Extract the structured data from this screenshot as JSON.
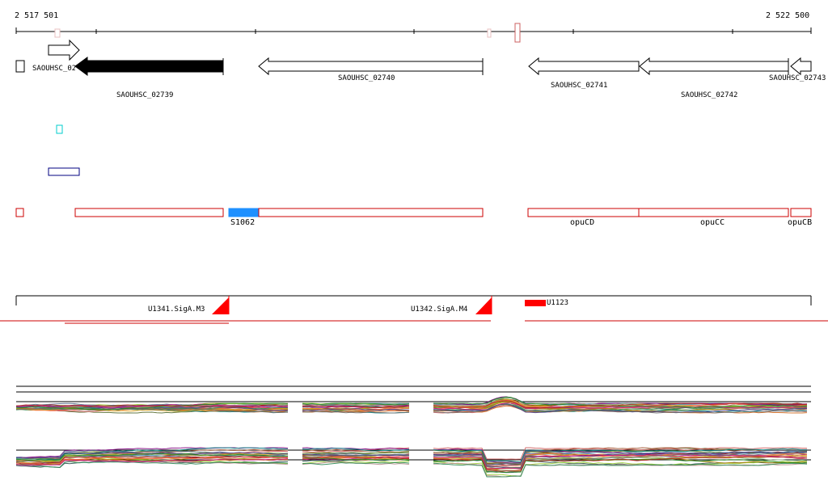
{
  "coordinates": {
    "start": "2 517 501",
    "end": "2 522 500"
  },
  "genes": [
    {
      "label": "SAOUHSC_02738",
      "shown": "SAOUHSC_02738"
    },
    {
      "label": "SAOUHSC_02739"
    },
    {
      "label": "SAOUHSC_02740"
    },
    {
      "label": "SAOUHSC_02741"
    },
    {
      "label": "SAOUHSC_02742"
    },
    {
      "label": "SAOUHSC_02743"
    }
  ],
  "annotations": [
    {
      "label": "S1062"
    },
    {
      "label": "opuCD"
    },
    {
      "label": "opuCC"
    },
    {
      "label": "opuCB"
    }
  ],
  "promoters": [
    {
      "label": "U1341.SigA.M3"
    },
    {
      "label": "U1342.SigA.M4"
    },
    {
      "label": "U1123"
    }
  ],
  "colors": {
    "gene_outline": "#000000",
    "gene_selected": "#000000",
    "annotation_outline": "#cc0000",
    "annotation_highlight": "#1e90ff",
    "promoter": "#ff0000",
    "feature_cyan": "#00cccc",
    "feature_blue": "#000080"
  }
}
